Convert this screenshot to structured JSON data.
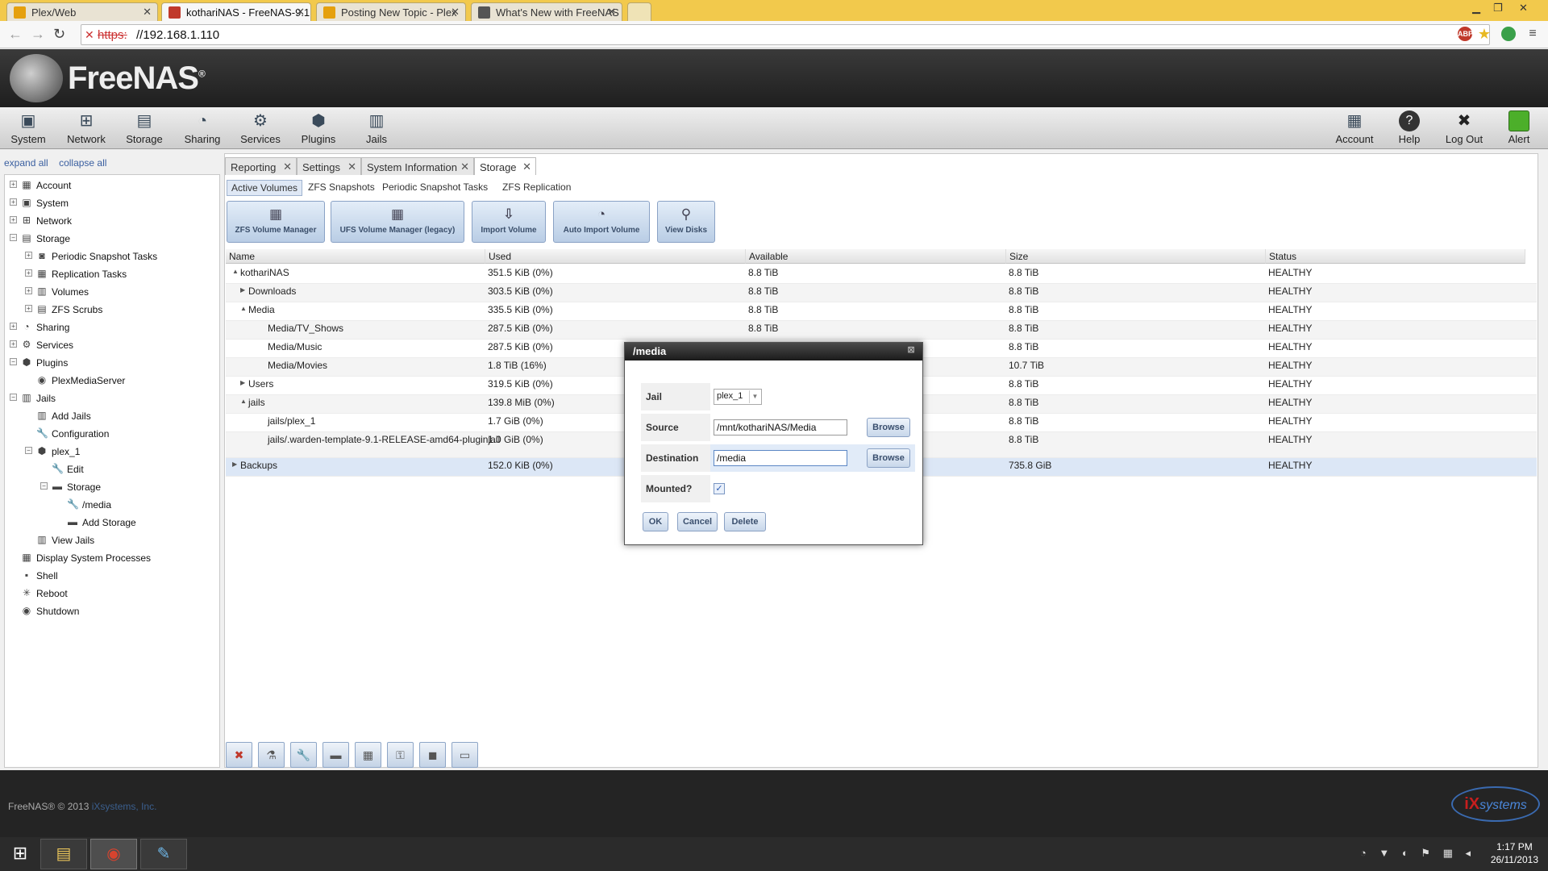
{
  "browser": {
    "tabs": [
      {
        "title": "Plex/Web",
        "favicon_color": "#e5a00d"
      },
      {
        "title": "kothariNAS - FreeNAS-9.1",
        "favicon_color": "#c0392b"
      },
      {
        "title": "Posting New Topic - Plex",
        "favicon_color": "#e5a00d"
      },
      {
        "title": "What's New with FreeNAS",
        "favicon_color": "#555555"
      }
    ],
    "url_protocol": "https:",
    "url_host": "//192.168.1.110",
    "ext_abp": "ABP"
  },
  "app": {
    "logo_text": "FreeNAS",
    "logo_mark": "®"
  },
  "mainnav": {
    "left": [
      {
        "label": "System",
        "icon": "system-icon",
        "glyph": "▣"
      },
      {
        "label": "Network",
        "icon": "network-icon",
        "glyph": "⊞"
      },
      {
        "label": "Storage",
        "icon": "storage-icon",
        "glyph": "▤"
      },
      {
        "label": "Sharing",
        "icon": "sharing-icon",
        "glyph": "◔"
      },
      {
        "label": "Services",
        "icon": "services-icon",
        "glyph": "⚙"
      },
      {
        "label": "Plugins",
        "icon": "plugins-icon",
        "glyph": "⬢"
      },
      {
        "label": "Jails",
        "icon": "jails-icon",
        "glyph": "▥"
      }
    ],
    "right": [
      {
        "label": "Account",
        "icon": "account-icon",
        "glyph": "▦"
      },
      {
        "label": "Help",
        "icon": "help-icon",
        "glyph": "?"
      },
      {
        "label": "Log Out",
        "icon": "logout-icon",
        "glyph": "✖"
      },
      {
        "label": "Alert",
        "icon": "alert-icon",
        "glyph": "■"
      }
    ]
  },
  "sidebar": {
    "expand_all": "expand all",
    "collapse_all": "collapse all",
    "items": [
      {
        "label": "Account",
        "level": 0,
        "toggle": "+",
        "icon": "account-icon",
        "glyph": "▦"
      },
      {
        "label": "System",
        "level": 0,
        "toggle": "+",
        "icon": "system-icon",
        "glyph": "▣"
      },
      {
        "label": "Network",
        "level": 0,
        "toggle": "+",
        "icon": "network-icon",
        "glyph": "⊞"
      },
      {
        "label": "Storage",
        "level": 0,
        "toggle": "−",
        "icon": "storage-icon",
        "glyph": "▤"
      },
      {
        "label": "Periodic Snapshot Tasks",
        "level": 1,
        "toggle": "+",
        "icon": "snapshot-icon",
        "glyph": "◙"
      },
      {
        "label": "Replication Tasks",
        "level": 1,
        "toggle": "+",
        "icon": "replication-icon",
        "glyph": "▦"
      },
      {
        "label": "Volumes",
        "level": 1,
        "toggle": "+",
        "icon": "volumes-icon",
        "glyph": "▥"
      },
      {
        "label": "ZFS Scrubs",
        "level": 1,
        "toggle": "+",
        "icon": "scrub-icon",
        "glyph": "▤"
      },
      {
        "label": "Sharing",
        "level": 0,
        "toggle": "+",
        "icon": "sharing-icon",
        "glyph": "◔"
      },
      {
        "label": "Services",
        "level": 0,
        "toggle": "+",
        "icon": "services-icon",
        "glyph": "⚙"
      },
      {
        "label": "Plugins",
        "level": 0,
        "toggle": "−",
        "icon": "plugins-icon",
        "glyph": "⬢"
      },
      {
        "label": "PlexMediaServer",
        "level": 1,
        "toggle": "",
        "icon": "plex-icon",
        "glyph": "◉"
      },
      {
        "label": "Jails",
        "level": 0,
        "toggle": "−",
        "icon": "jails-icon",
        "glyph": "▥"
      },
      {
        "label": "Add Jails",
        "level": 1,
        "toggle": "",
        "icon": "add-jails-icon",
        "glyph": "▥"
      },
      {
        "label": "Configuration",
        "level": 1,
        "toggle": "",
        "icon": "wrench-icon",
        "glyph": "🔧"
      },
      {
        "label": "plex_1",
        "level": 1,
        "toggle": "−",
        "icon": "jail-icon",
        "glyph": "⬢"
      },
      {
        "label": "Edit",
        "level": 2,
        "toggle": "",
        "icon": "wrench-icon",
        "glyph": "🔧"
      },
      {
        "label": "Storage",
        "level": 2,
        "toggle": "−",
        "icon": "folder-icon",
        "glyph": "▬"
      },
      {
        "label": "/media",
        "level": 3,
        "toggle": "",
        "icon": "wrench-icon",
        "glyph": "🔧"
      },
      {
        "label": "Add Storage",
        "level": 3,
        "toggle": "",
        "icon": "folder-icon",
        "glyph": "▬"
      },
      {
        "label": "View Jails",
        "level": 1,
        "toggle": "",
        "icon": "view-jails-icon",
        "glyph": "▥"
      },
      {
        "label": "Display System Processes",
        "level": 0,
        "toggle": "",
        "icon": "processes-icon",
        "glyph": "▦"
      },
      {
        "label": "Shell",
        "level": 0,
        "toggle": "",
        "icon": "shell-icon",
        "glyph": "▪"
      },
      {
        "label": "Reboot",
        "level": 0,
        "toggle": "",
        "icon": "reboot-icon",
        "glyph": "✳"
      },
      {
        "label": "Shutdown",
        "level": 0,
        "toggle": "",
        "icon": "shutdown-icon",
        "glyph": "◉"
      }
    ]
  },
  "content": {
    "tabs": [
      "Reporting",
      "Settings",
      "System Information",
      "Storage"
    ],
    "active_tab": 3,
    "subtabs": [
      "Active Volumes",
      "ZFS Snapshots",
      "Periodic Snapshot Tasks",
      "ZFS Replication"
    ],
    "toolbar": [
      {
        "label": "ZFS Volume Manager",
        "icon": "zfs-volume-manager-icon",
        "glyph": "▦"
      },
      {
        "label": "UFS Volume Manager (legacy)",
        "icon": "ufs-volume-manager-icon",
        "glyph": "▦"
      },
      {
        "label": "Import Volume",
        "icon": "import-volume-icon",
        "glyph": "⇩"
      },
      {
        "label": "Auto Import Volume",
        "icon": "auto-import-icon",
        "glyph": "◔"
      },
      {
        "label": "View Disks",
        "icon": "view-disks-icon",
        "glyph": "⚲"
      }
    ],
    "columns": [
      "Name",
      "Used",
      "Available",
      "Size",
      "Status"
    ],
    "rows": [
      {
        "name": "kothariNAS",
        "arrow": "▲",
        "indent": 0,
        "used": "351.5 KiB (0%)",
        "available": "8.8 TiB",
        "size": "8.8 TiB",
        "status": "HEALTHY"
      },
      {
        "name": "Downloads",
        "arrow": "▶",
        "indent": 1,
        "used": "303.5 KiB (0%)",
        "available": "8.8 TiB",
        "size": "8.8 TiB",
        "status": "HEALTHY"
      },
      {
        "name": "Media",
        "arrow": "▲",
        "indent": 1,
        "used": "335.5 KiB (0%)",
        "available": "8.8 TiB",
        "size": "8.8 TiB",
        "status": "HEALTHY"
      },
      {
        "name": "Media/TV_Shows",
        "arrow": "",
        "indent": 2,
        "used": "287.5 KiB (0%)",
        "available": "8.8 TiB",
        "size": "8.8 TiB",
        "status": "HEALTHY"
      },
      {
        "name": "Media/Music",
        "arrow": "",
        "indent": 2,
        "used": "287.5 KiB (0%)",
        "available": "",
        "size": "8.8 TiB",
        "status": "HEALTHY"
      },
      {
        "name": "Media/Movies",
        "arrow": "",
        "indent": 2,
        "used": "1.8 TiB (16%)",
        "available": "",
        "size": "10.7 TiB",
        "status": "HEALTHY"
      },
      {
        "name": "Users",
        "arrow": "▶",
        "indent": 1,
        "used": "319.5 KiB (0%)",
        "available": "",
        "size": "8.8 TiB",
        "status": "HEALTHY"
      },
      {
        "name": "jails",
        "arrow": "▲",
        "indent": 1,
        "used": "139.8 MiB (0%)",
        "available": "",
        "size": "8.8 TiB",
        "status": "HEALTHY"
      },
      {
        "name": "jails/plex_1",
        "arrow": "",
        "indent": 2,
        "used": "1.7 GiB (0%)",
        "available": "",
        "size": "8.8 TiB",
        "status": "HEALTHY"
      },
      {
        "name": "jails/.warden-template-9.1-RELEASE-amd64-pluginjail",
        "arrow": "",
        "indent": 2,
        "used": "1.0 GiB (0%)",
        "available": "",
        "size": "8.8 TiB",
        "status": "HEALTHY"
      },
      {
        "name": "Backups",
        "arrow": "▶",
        "indent": 0,
        "used": "152.0 KiB (0%)",
        "available": "",
        "size": "735.8 GiB",
        "status": "HEALTHY"
      }
    ],
    "actions": [
      {
        "icon": "detach-volume-icon",
        "glyph": "✖"
      },
      {
        "icon": "scrub-volume-icon",
        "glyph": "⚗"
      },
      {
        "icon": "edit-options-icon",
        "glyph": "🔧"
      },
      {
        "icon": "create-dataset-icon",
        "glyph": "▬"
      },
      {
        "icon": "create-zvol-icon",
        "glyph": "▦"
      },
      {
        "icon": "change-permissions-icon",
        "glyph": "⚿"
      },
      {
        "icon": "create-snapshot-icon",
        "glyph": "◼"
      },
      {
        "icon": "volume-status-icon",
        "glyph": "▭"
      }
    ]
  },
  "dialog": {
    "title": "/media",
    "jail_label": "Jail",
    "jail_value": "plex_1",
    "source_label": "Source",
    "source_value": "/mnt/kothariNAS/Media",
    "destination_label": "Destination",
    "destination_value": "/media",
    "mounted_label": "Mounted?",
    "mounted_checked": true,
    "browse_label": "Browse",
    "ok_label": "OK",
    "cancel_label": "Cancel",
    "delete_label": "Delete"
  },
  "footer": {
    "copyright": "FreeNAS® © 2013",
    "link": "iXsystems, Inc.",
    "logo_mark": "iX",
    "logo_text": "systems"
  },
  "taskbar": {
    "apps": [
      {
        "icon": "file-explorer-icon",
        "glyph": "▤"
      },
      {
        "icon": "chrome-icon",
        "glyph": "◉"
      },
      {
        "icon": "paint-icon",
        "glyph": "✎"
      }
    ],
    "tray": "◔ ▼ ◐ ⚑ ▦ ◂",
    "time": "1:17 PM",
    "date": "26/11/2013"
  }
}
